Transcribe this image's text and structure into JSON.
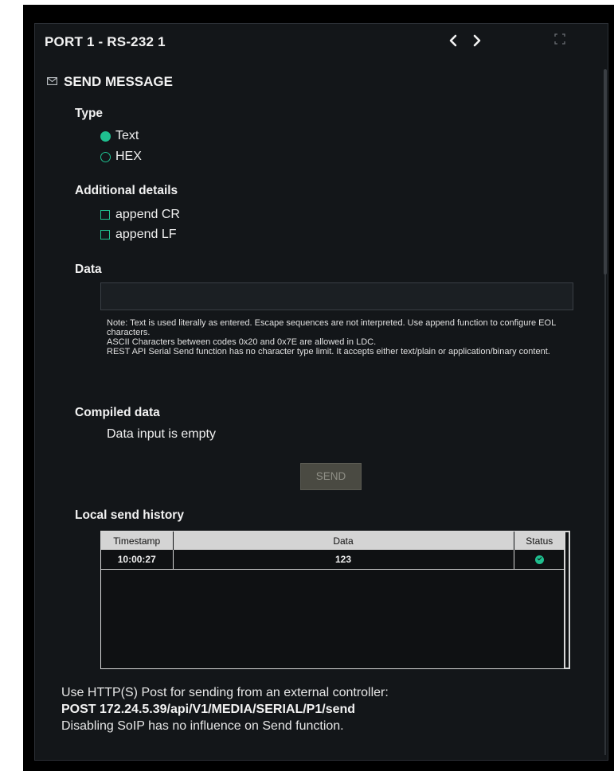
{
  "panel": {
    "title": "PORT 1 - RS-232 1",
    "prev_icon": "chevron-left-icon",
    "next_icon": "chevron-right-icon",
    "expand_icon": "expand-icon"
  },
  "send_message": {
    "heading": "SEND MESSAGE",
    "heading_icon": "envelope-icon",
    "type_label": "Type",
    "type_options": [
      {
        "label": "Text",
        "selected": true
      },
      {
        "label": "HEX",
        "selected": false
      }
    ],
    "additional_label": "Additional details",
    "additional_options": [
      {
        "label": "append CR",
        "checked": false
      },
      {
        "label": "append LF",
        "checked": false
      }
    ],
    "data_label": "Data",
    "data_value": "",
    "note_lines": [
      "Note: Text is used literally as entered. Escape sequences are not interpreted. Use append function to configure EOL characters.",
      "ASCII Characters between codes 0x20 and 0x7E are allowed in LDC.",
      "REST API Serial Send function has no character type limit. It accepts either text/plain or application/binary content."
    ],
    "compiled_label": "Compiled data",
    "compiled_value": "Data input is empty",
    "send_label": "SEND"
  },
  "history": {
    "label": "Local send history",
    "columns": [
      "Timestamp",
      "Data",
      "Status"
    ],
    "rows": [
      {
        "timestamp": "10:00:27",
        "data": "123",
        "status": "success-icon"
      }
    ]
  },
  "footer": {
    "line1": "Use HTTP(S) Post for sending from an external controller:",
    "line2": "POST 172.24.5.39/api/V1/MEDIA/SERIAL/P1/send",
    "line3": "Disabling SoIP has no influence on Send function."
  },
  "colors": {
    "accent": "#1fbf8f",
    "panel_bg": "#131619",
    "send_button_bg": "#4a4a42"
  }
}
